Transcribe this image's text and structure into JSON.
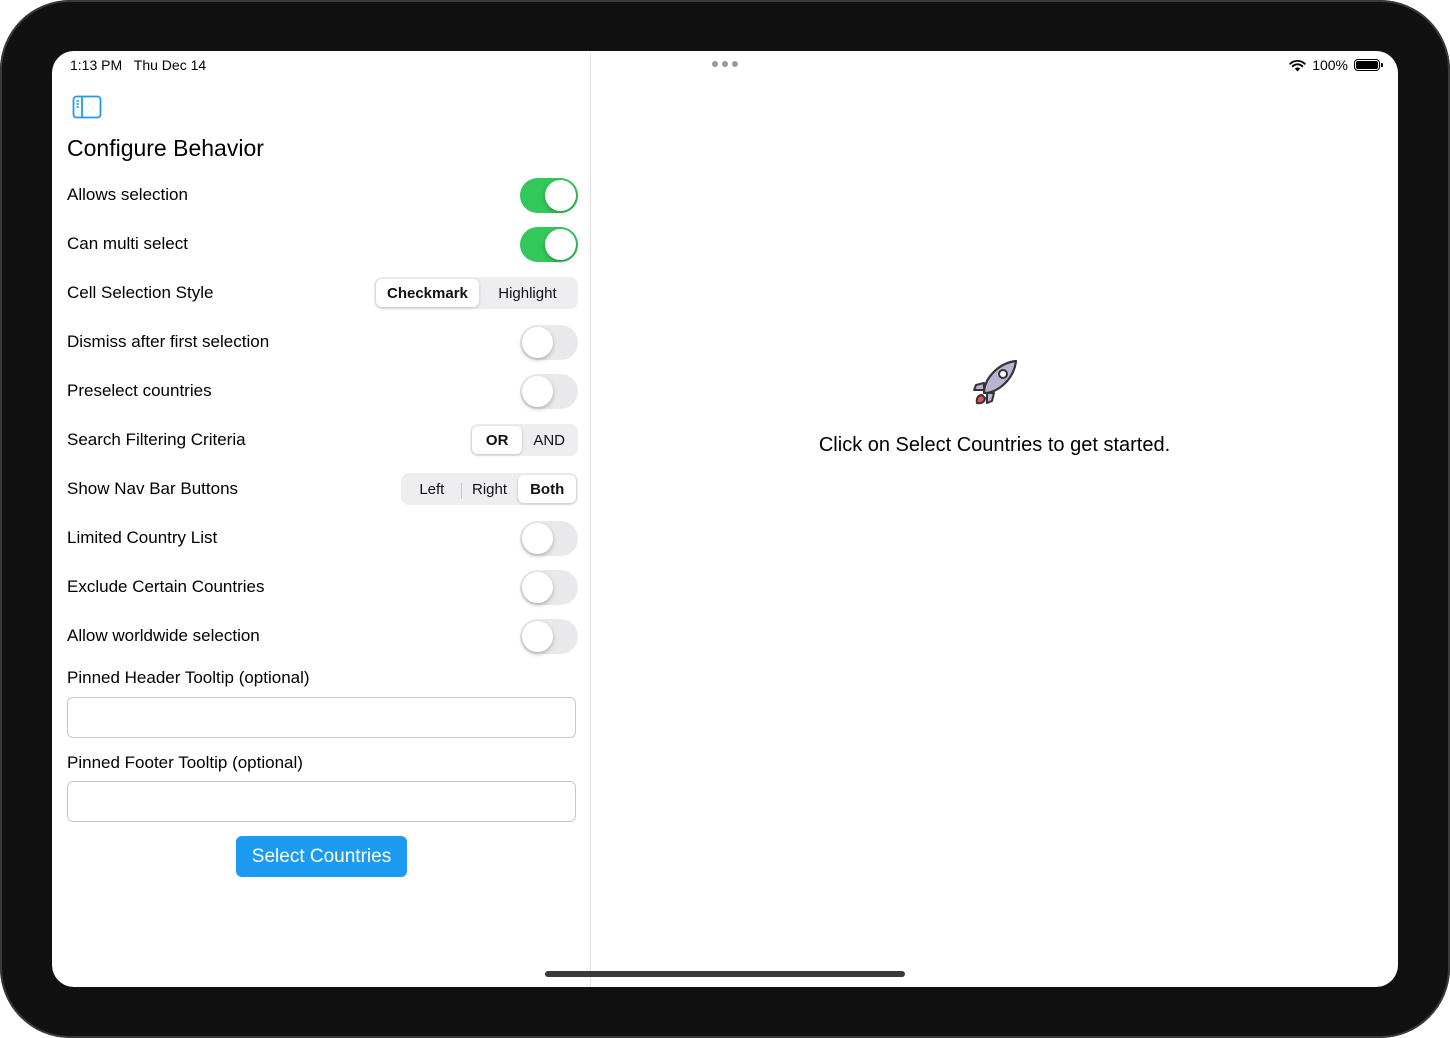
{
  "status_bar": {
    "time": "1:13 PM",
    "date": "Thu Dec 14",
    "battery": "100%",
    "wifi_icon": "wifi-icon",
    "battery_icon": "battery-icon"
  },
  "sidebar": {
    "toggle_icon": "sidebar-toggle-icon",
    "title": "Configure Behavior",
    "rows": [
      {
        "label": "Allows selection",
        "control": "switch",
        "on": true
      },
      {
        "label": "Can multi select",
        "control": "switch",
        "on": true
      },
      {
        "label": "Cell Selection Style",
        "control": "segmented",
        "options": [
          "Checkmark",
          "Highlight"
        ],
        "selected": "Checkmark"
      },
      {
        "label": "Dismiss after first selection",
        "control": "switch",
        "on": false
      },
      {
        "label": "Preselect countries",
        "control": "switch",
        "on": false
      },
      {
        "label": "Search Filtering Criteria",
        "control": "segmented",
        "options": [
          "OR",
          "AND"
        ],
        "selected": "OR"
      },
      {
        "label": "Show Nav Bar Buttons",
        "control": "segmented",
        "options": [
          "Left",
          "Right",
          "Both"
        ],
        "selected": "Both"
      },
      {
        "label": "Limited Country List",
        "control": "switch",
        "on": false
      },
      {
        "label": "Exclude Certain Countries",
        "control": "switch",
        "on": false
      },
      {
        "label": "Allow worldwide selection",
        "control": "switch",
        "on": false
      }
    ],
    "header_tooltip": {
      "label": "Pinned Header Tooltip (optional)",
      "value": ""
    },
    "footer_tooltip": {
      "label": "Pinned Footer Tooltip (optional)",
      "value": ""
    },
    "select_button": "Select Countries"
  },
  "detail": {
    "icon": "rocket-icon",
    "message": "Click on Select Countries to get started."
  },
  "colors": {
    "switch_on": "#34c759",
    "switch_off": "#e9e9eb",
    "accent": "#1d9bf0"
  }
}
